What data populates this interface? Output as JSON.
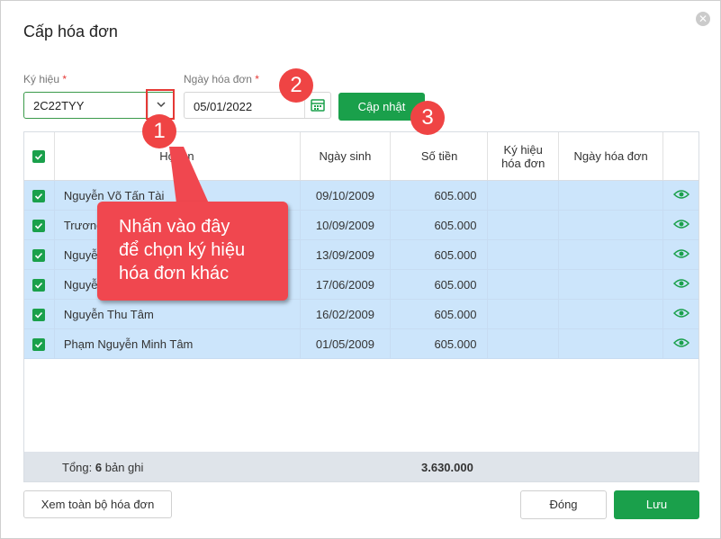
{
  "dialog": {
    "title": "Cấp hóa đơn"
  },
  "form": {
    "symbol_label": "Ký hiệu",
    "symbol_value": "2C22TYY",
    "date_label": "Ngày hóa đơn",
    "date_value": "05/01/2022",
    "required_mark": "*",
    "update_button": "Cập nhật"
  },
  "table": {
    "headers": {
      "name": "Họ tên",
      "dob": "Ngày sinh",
      "amount": "Số tiền",
      "symbol_l1": "Ký hiệu",
      "symbol_l2": "hóa đơn",
      "invoice_date": "Ngày hóa đơn"
    },
    "rows": [
      {
        "name": "Nguyễn Võ Tấn Tài",
        "dob": "09/10/2009",
        "amount": "605.000"
      },
      {
        "name": "Trương",
        "dob": "10/09/2009",
        "amount": "605.000"
      },
      {
        "name": "Nguyễ",
        "dob": "13/09/2009",
        "amount": "605.000"
      },
      {
        "name": "Nguyễ",
        "dob": "17/06/2009",
        "amount": "605.000"
      },
      {
        "name": "Nguyễn Thu Tâm",
        "dob": "16/02/2009",
        "amount": "605.000"
      },
      {
        "name": "Phạm Nguyễn Minh Tâm",
        "dob": "01/05/2009",
        "amount": "605.000"
      }
    ],
    "footer": {
      "total_prefix": "Tổng:",
      "total_count": "6",
      "total_suffix": "bản ghi",
      "sum": "3.630.000"
    }
  },
  "buttons": {
    "view_all": "Xem toàn bộ hóa đơn",
    "close": "Đóng",
    "save": "Lưu"
  },
  "annotations": {
    "badge1": "1",
    "badge2": "2",
    "badge3": "3",
    "callout_l1": "Nhấn vào đây",
    "callout_l2": "để chọn ký hiệu",
    "callout_l3": "hóa đơn khác"
  },
  "colors": {
    "accent": "#1aa04b",
    "row_selected": "#cce5fb",
    "annotation": "#ef4444"
  }
}
